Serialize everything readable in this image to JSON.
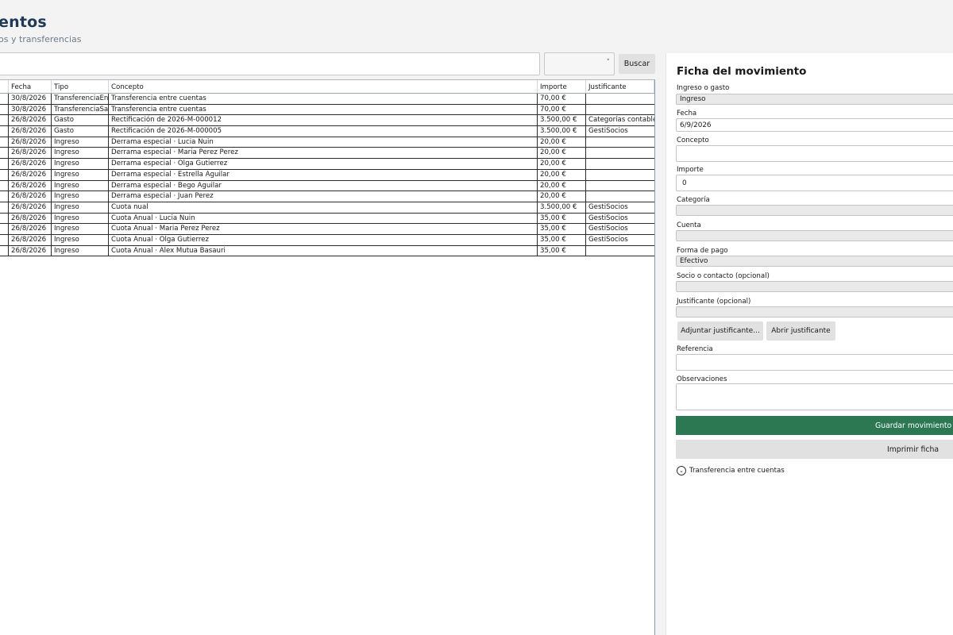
{
  "header": {
    "title": "entos",
    "subtitle": "os y transferencias"
  },
  "toolbar": {
    "search_value": "",
    "filter_selected": "",
    "search_button": "Buscar"
  },
  "table": {
    "columns": [
      "Fecha",
      "Tipo",
      "Concepto",
      "Importe",
      "Justificante"
    ],
    "rows": [
      {
        "fecha": "30/8/2026",
        "tipo": "TransferenciaEntr",
        "concepto": "Transferencia entre cuentas",
        "importe": "70,00 €",
        "justificante": ""
      },
      {
        "fecha": "30/8/2026",
        "tipo": "TransferenciaSalid",
        "concepto": "Transferencia entre cuentas",
        "importe": "70,00 €",
        "justificante": ""
      },
      {
        "fecha": "26/8/2026",
        "tipo": "Gasto",
        "concepto": "Rectificación de 2026-M-000012",
        "importe": "3.500,00 €",
        "justificante": "Categorías contables"
      },
      {
        "fecha": "26/8/2026",
        "tipo": "Gasto",
        "concepto": "Rectificación de 2026-M-000005",
        "importe": "3.500,00 €",
        "justificante": "GestiSocios"
      },
      {
        "fecha": "26/8/2026",
        "tipo": "Ingreso",
        "concepto": "Derrama  especial · Lucia Nuin",
        "importe": "20,00 €",
        "justificante": ""
      },
      {
        "fecha": "26/8/2026",
        "tipo": "Ingreso",
        "concepto": "Derrama  especial · Maria Perez Perez",
        "importe": "20,00 €",
        "justificante": ""
      },
      {
        "fecha": "26/8/2026",
        "tipo": "Ingreso",
        "concepto": "Derrama  especial · Olga Gutierrez",
        "importe": "20,00 €",
        "justificante": ""
      },
      {
        "fecha": "26/8/2026",
        "tipo": "Ingreso",
        "concepto": "Derrama  especial · Estrella Aguilar",
        "importe": "20,00 €",
        "justificante": ""
      },
      {
        "fecha": "26/8/2026",
        "tipo": "Ingreso",
        "concepto": "Derrama  especial · Bego Aguilar",
        "importe": "20,00 €",
        "justificante": ""
      },
      {
        "fecha": "26/8/2026",
        "tipo": "Ingreso",
        "concepto": "Derrama  especial · Juan Perez",
        "importe": "20,00 €",
        "justificante": ""
      },
      {
        "fecha": "26/8/2026",
        "tipo": "Ingreso",
        "concepto": "Cuota nual",
        "importe": "3.500,00 €",
        "justificante": "GestiSocios"
      },
      {
        "fecha": "26/8/2026",
        "tipo": "Ingreso",
        "concepto": "Cuota Anual · Lucia Nuin",
        "importe": "35,00 €",
        "justificante": "GestiSocios"
      },
      {
        "fecha": "26/8/2026",
        "tipo": "Ingreso",
        "concepto": "Cuota Anual · Maria Perez Perez",
        "importe": "35,00 €",
        "justificante": "GestiSocios"
      },
      {
        "fecha": "26/8/2026",
        "tipo": "Ingreso",
        "concepto": "Cuota Anual · Olga Gutierrez",
        "importe": "35,00 €",
        "justificante": "GestiSocios"
      },
      {
        "fecha": "26/8/2026",
        "tipo": "Ingreso",
        "concepto": "Cuota Anual · Alex Mutua Basauri",
        "importe": "35,00 €",
        "justificante": ""
      }
    ]
  },
  "form": {
    "title": "Ficha del movimiento",
    "ingreso_gasto_label": "Ingreso o gasto",
    "ingreso_gasto_value": "Ingreso",
    "fecha_label": "Fecha",
    "fecha_value": "6/9/2026",
    "concepto_label": "Concepto",
    "concepto_value": "",
    "importe_label": "Importe",
    "importe_value": "0",
    "categoria_label": "Categoría",
    "categoria_value": "",
    "cuenta_label": "Cuenta",
    "cuenta_value": "",
    "forma_pago_label": "Forma de pago",
    "forma_pago_value": "Efectivo",
    "socio_label": "Socio o contacto (opcional)",
    "socio_value": "",
    "justificante_label": "Justificante (opcional)",
    "justificante_value": "",
    "adjuntar_button": "Adjuntar justificante...",
    "abrir_button": "Abrir justificante",
    "referencia_label": "Referencia",
    "referencia_value": "",
    "observaciones_label": "Observaciones",
    "observaciones_value": "",
    "save_button": "Guardar movimiento",
    "print_button": "Imprimir ficha",
    "expander_label": "Transferencia entre cuentas"
  },
  "colors": {
    "primary_button": "#2c7853",
    "title_color": "#1e3a56"
  },
  "icons": {
    "filter_dropdown": "chevron-down-icon",
    "expander": "chevron-down-circle-icon"
  }
}
